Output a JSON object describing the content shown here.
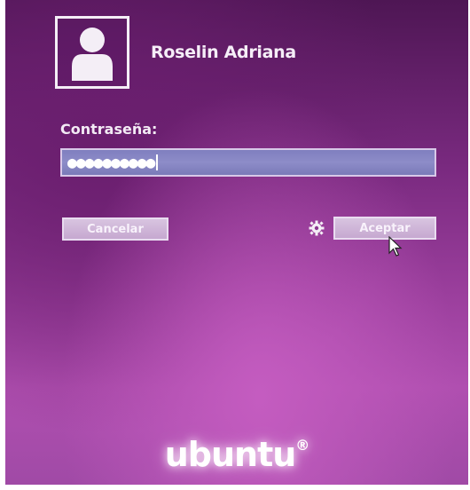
{
  "user": {
    "name": "Roselin Adriana"
  },
  "password": {
    "label": "Contraseña:",
    "masked_value": "●●●●●●●●●●"
  },
  "buttons": {
    "cancel_label": "Cancelar",
    "accept_label": "Aceptar"
  },
  "icons": {
    "avatar": "user-icon",
    "settings": "gear-icon",
    "pointer": "mouse-pointer-icon"
  },
  "branding": {
    "logo_text": "ubuntu",
    "logo_mark": "®"
  },
  "colors": {
    "background": "#7a2a80",
    "field": "#8584c4",
    "text": "#f6eef8"
  }
}
